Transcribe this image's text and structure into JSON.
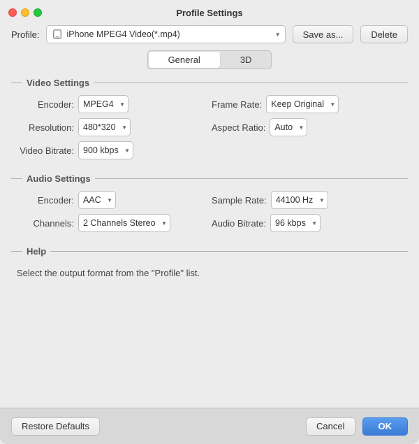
{
  "window": {
    "title": "Profile Settings"
  },
  "profile": {
    "label": "Profile:",
    "selected": "iPhone MPEG4 Video(*.mp4)",
    "save_as": "Save as...",
    "delete": "Delete"
  },
  "tabs": [
    {
      "id": "general",
      "label": "General",
      "active": true
    },
    {
      "id": "3d",
      "label": "3D",
      "active": false
    }
  ],
  "video_settings": {
    "title": "Video Settings",
    "encoder_label": "Encoder:",
    "encoder_value": "MPEG4",
    "frame_rate_label": "Frame Rate:",
    "frame_rate_value": "Keep Original",
    "resolution_label": "Resolution:",
    "resolution_value": "480*320",
    "aspect_ratio_label": "Aspect Ratio:",
    "aspect_ratio_value": "Auto",
    "video_bitrate_label": "Video Bitrate:",
    "video_bitrate_value": "900 kbps"
  },
  "audio_settings": {
    "title": "Audio Settings",
    "encoder_label": "Encoder:",
    "encoder_value": "AAC",
    "sample_rate_label": "Sample Rate:",
    "sample_rate_value": "44100 Hz",
    "channels_label": "Channels:",
    "channels_value": "2 Channels Stereo",
    "audio_bitrate_label": "Audio Bitrate:",
    "audio_bitrate_value": "96 kbps"
  },
  "help": {
    "title": "Help",
    "text": "Select the output format from the \"Profile\" list."
  },
  "footer": {
    "restore_defaults": "Restore Defaults",
    "cancel": "Cancel",
    "ok": "OK"
  }
}
